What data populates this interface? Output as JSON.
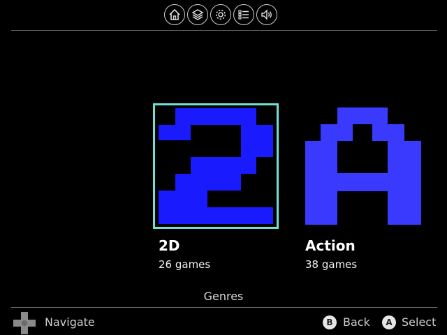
{
  "top_nav": {
    "icons": [
      "home-icon",
      "layers-icon",
      "gear-icon",
      "list-icon",
      "speaker-icon"
    ]
  },
  "genres": [
    {
      "title": "2D",
      "count": "26 games",
      "selected": true,
      "color": "#1a1aff"
    },
    {
      "title": "Action",
      "count": "38 games",
      "selected": false,
      "color": "#3a3aff"
    }
  ],
  "section_label": "Genres",
  "footer": {
    "navigate_label": "Navigate",
    "back_button": "B",
    "back_label": "Back",
    "select_button": "A",
    "select_label": "Select"
  },
  "colors": {
    "selection_border": "#6fe0d4",
    "background": "#000000"
  }
}
